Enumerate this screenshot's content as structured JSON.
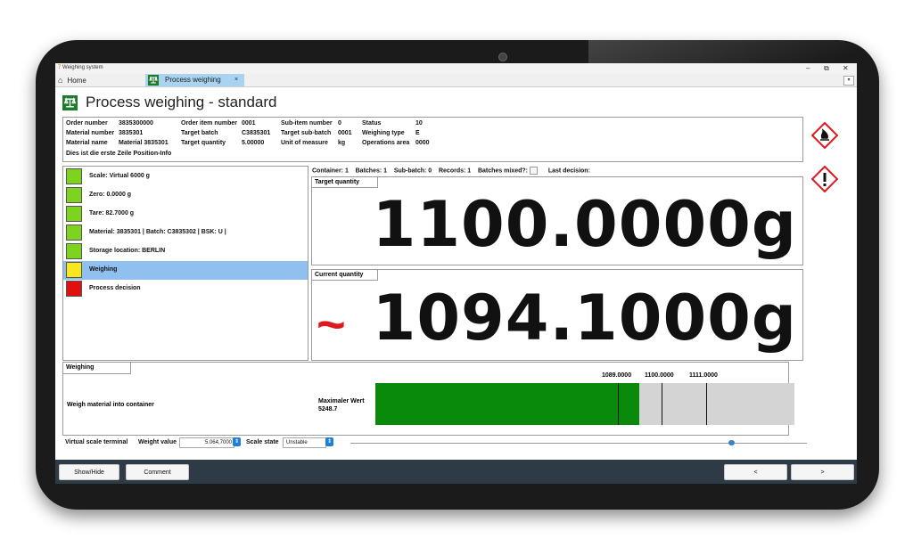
{
  "window": {
    "app_title": "Weighing system",
    "minimize": "–",
    "restore": "⧉",
    "close": "✕"
  },
  "tabs": {
    "home": "Home",
    "active": "Process weighing",
    "close": "×",
    "dropdown": "▾"
  },
  "page": {
    "title": "Process weighing - standard"
  },
  "info": {
    "order_number_label": "Order number",
    "order_number": "3835300000",
    "material_number_label": "Material number",
    "material_number": "3835301",
    "material_name_label": "Material name",
    "material_name": "Material 3835301",
    "position_info": "Dies ist die erste Zeile Position-Info",
    "order_item_label": "Order item number",
    "order_item": "0001",
    "target_batch_label": "Target batch",
    "target_batch": "C3835301",
    "target_qty_label": "Target quantity",
    "target_qty": "5.00000",
    "subitem_label": "Sub-item number",
    "subitem": "0",
    "target_subbatch_label": "Target sub-batch",
    "target_subbatch": "0001",
    "uom_label": "Unit of measure",
    "uom": "kg",
    "status_label": "Status",
    "status": "10",
    "weighing_type_label": "Weighing type",
    "weighing_type": "E",
    "ops_area_label": "Operations area",
    "ops_area": "0000"
  },
  "steps": [
    {
      "label": "Scale: Virtual 6000 g",
      "color": "#7ed321"
    },
    {
      "label": "Zero: 0.0000 g",
      "color": "#7ed321"
    },
    {
      "label": "Tare: 82.7000 g",
      "color": "#7ed321"
    },
    {
      "label": "Material: 3835301 | Batch: C3835302 | BSK: U |",
      "color": "#7ed321"
    },
    {
      "label": "Storage location: BERLIN",
      "color": "#7ed321"
    },
    {
      "label": "Weighing",
      "color": "#f8e71c"
    },
    {
      "label": "Process decision",
      "color": "#e01010"
    }
  ],
  "status_line": {
    "container": "Container: 1",
    "batches": "Batches: 1",
    "subbatch": "Sub-batch: 0",
    "records": "Records: 1",
    "mixed": "Batches mixed?:",
    "last": "Last decision:"
  },
  "target": {
    "label": "Target quantity",
    "value": "1100.0000g"
  },
  "current": {
    "label": "Current quantity",
    "value": "1094.1000g",
    "indicator": "~"
  },
  "weighing": {
    "label": "Weighing",
    "description": "Weigh material into container",
    "max_label": "Maximaler Wert",
    "max_value": "5248.7",
    "ticks": [
      "1089.0000",
      "1100.0000",
      "1111.0000"
    ],
    "fill_fraction": 0.63
  },
  "terminal": {
    "label": "Virtual scale terminal",
    "weight_label": "Weight value",
    "weight_value": "5.064,7000",
    "state_label": "Scale state",
    "state_value": "Unstable",
    "spin": "⇕"
  },
  "footer": {
    "show_hide": "Show/Hide",
    "comment": "Comment",
    "prev": "<",
    "next": ">"
  },
  "colors": {
    "accent_green": "#0a8a0a",
    "tab_active": "#a8d3f1",
    "hazard_red": "#e0191e"
  }
}
